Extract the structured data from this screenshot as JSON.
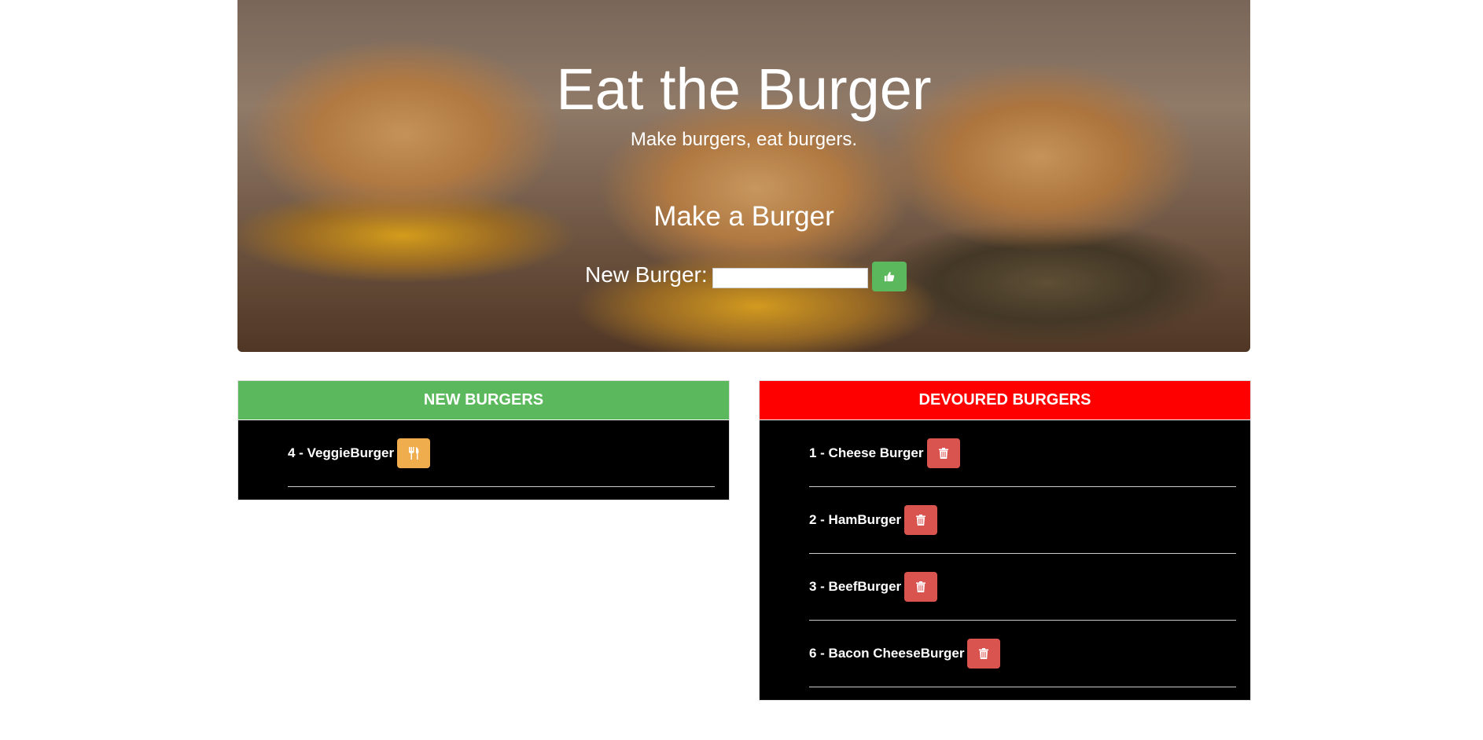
{
  "hero": {
    "title": "Eat the Burger",
    "subtitle": "Make burgers, eat burgers."
  },
  "form": {
    "title": "Make a Burger",
    "label": "New Burger:",
    "input_value": "",
    "submit_icon": "thumbs-up-icon"
  },
  "new_burgers": {
    "heading": "NEW BURGERS",
    "color": "#5cb85c",
    "items": [
      {
        "label": "4 - VeggieBurger",
        "button_icon": "utensils-icon",
        "button_color": "#f0ad4e"
      }
    ]
  },
  "devoured_burgers": {
    "heading": "DEVOURED BURGERS",
    "color": "#ff0000",
    "items": [
      {
        "label": "1 - Cheese Burger",
        "button_icon": "trash-icon",
        "button_color": "#d9534f"
      },
      {
        "label": "2 - HamBurger",
        "button_icon": "trash-icon",
        "button_color": "#d9534f"
      },
      {
        "label": "3 - BeefBurger",
        "button_icon": "trash-icon",
        "button_color": "#d9534f"
      },
      {
        "label": "6 - Bacon CheeseBurger",
        "button_icon": "trash-icon",
        "button_color": "#d9534f"
      }
    ]
  }
}
